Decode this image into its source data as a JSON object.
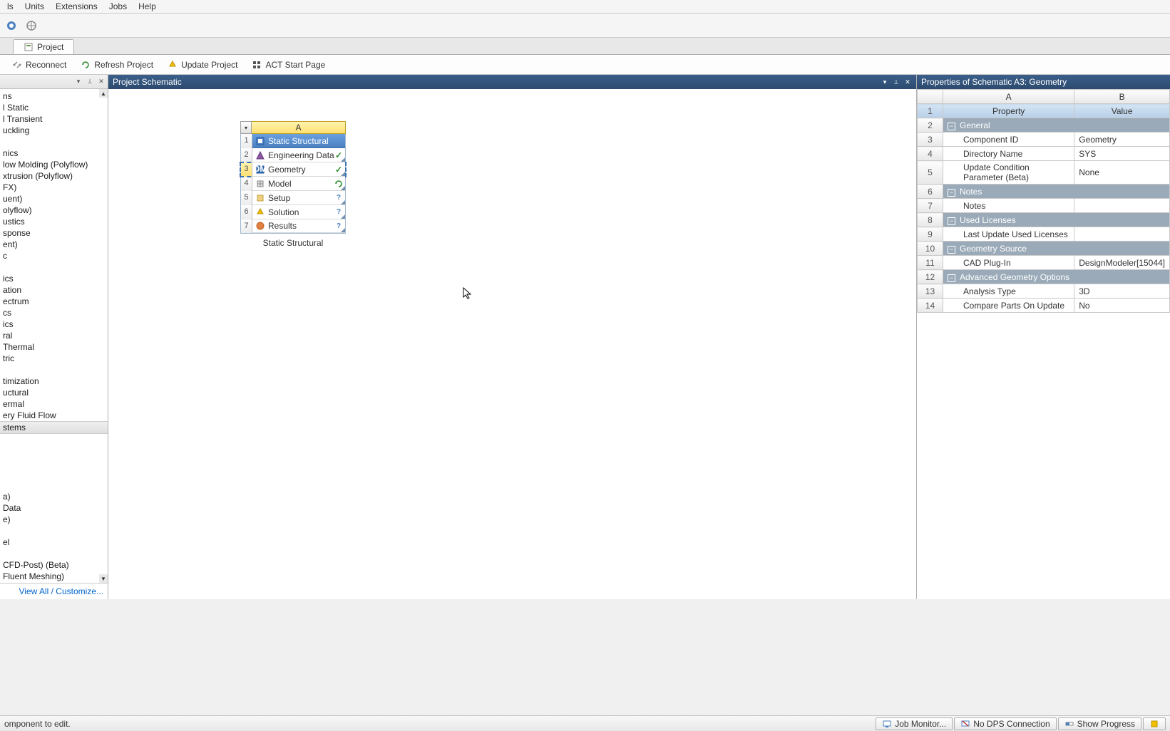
{
  "menu": {
    "items": [
      "ls",
      "Units",
      "Extensions",
      "Jobs",
      "Help"
    ]
  },
  "tabs": {
    "project": "Project"
  },
  "actions": {
    "reconnect": "Reconnect",
    "refresh": "Refresh Project",
    "update": "Update Project",
    "act": "ACT Start Page"
  },
  "toolbox": {
    "items": [
      "ns",
      "l Static",
      "l Transient",
      "uckling",
      "",
      "nics",
      "low Molding (Polyflow)",
      "xtrusion (Polyflow)",
      "FX)",
      "uent)",
      "olyflow)",
      "ustics",
      "sponse",
      "ent)",
      "c",
      "",
      "ics",
      "ation",
      "ectrum",
      "cs",
      "ics",
      "ral",
      "Thermal",
      "tric",
      "",
      "timization",
      "uctural",
      "ermal",
      "ery Fluid Flow",
      "stems",
      "",
      "",
      "",
      "",
      "",
      "a)",
      "Data",
      "e)",
      "",
      "el",
      "",
      "CFD-Post) (Beta)",
      "Fluent Meshing)"
    ],
    "group_header_index": 29,
    "view_all": "View All / Customize..."
  },
  "schematic": {
    "pane_title": "Project Schematic",
    "system": {
      "col_letter": "A",
      "caption": "Static Structural",
      "rows": [
        {
          "num": "1",
          "label": "Static Structural",
          "status": "",
          "title": true
        },
        {
          "num": "2",
          "label": "Engineering Data",
          "status": "check"
        },
        {
          "num": "3",
          "label": "Geometry",
          "status": "check",
          "selected": true
        },
        {
          "num": "4",
          "label": "Model",
          "status": "refresh"
        },
        {
          "num": "5",
          "label": "Setup",
          "status": "question"
        },
        {
          "num": "6",
          "label": "Solution",
          "status": "question"
        },
        {
          "num": "7",
          "label": "Results",
          "status": "question"
        }
      ]
    }
  },
  "properties": {
    "pane_title": "Properties of Schematic A3: Geometry",
    "col_a": "A",
    "col_b": "B",
    "header_property": "Property",
    "header_value": "Value",
    "rows": [
      {
        "n": "1",
        "type": "header"
      },
      {
        "n": "2",
        "type": "group",
        "label": "General"
      },
      {
        "n": "3",
        "type": "prop",
        "label": "Component ID",
        "value": "Geometry"
      },
      {
        "n": "4",
        "type": "prop",
        "label": "Directory Name",
        "value": "SYS"
      },
      {
        "n": "5",
        "type": "prop",
        "label": "Update Condition Parameter (Beta)",
        "value": "None"
      },
      {
        "n": "6",
        "type": "group",
        "label": "Notes"
      },
      {
        "n": "7",
        "type": "prop",
        "label": "Notes",
        "value": ""
      },
      {
        "n": "8",
        "type": "group",
        "label": "Used Licenses"
      },
      {
        "n": "9",
        "type": "prop",
        "label": "Last Update Used Licenses",
        "value": ""
      },
      {
        "n": "10",
        "type": "group",
        "label": "Geometry Source"
      },
      {
        "n": "11",
        "type": "prop",
        "label": "CAD Plug-In",
        "value": "DesignModeler[15044]"
      },
      {
        "n": "12",
        "type": "group",
        "label": "Advanced Geometry Options"
      },
      {
        "n": "13",
        "type": "prop",
        "label": "Analysis Type",
        "value": "3D"
      },
      {
        "n": "14",
        "type": "prop",
        "label": "Compare Parts On Update",
        "value": "No"
      }
    ]
  },
  "statusbar": {
    "hint": "omponent to edit.",
    "job_monitor": "Job Monitor...",
    "dps": "No DPS Connection",
    "progress": "Show Progress"
  }
}
